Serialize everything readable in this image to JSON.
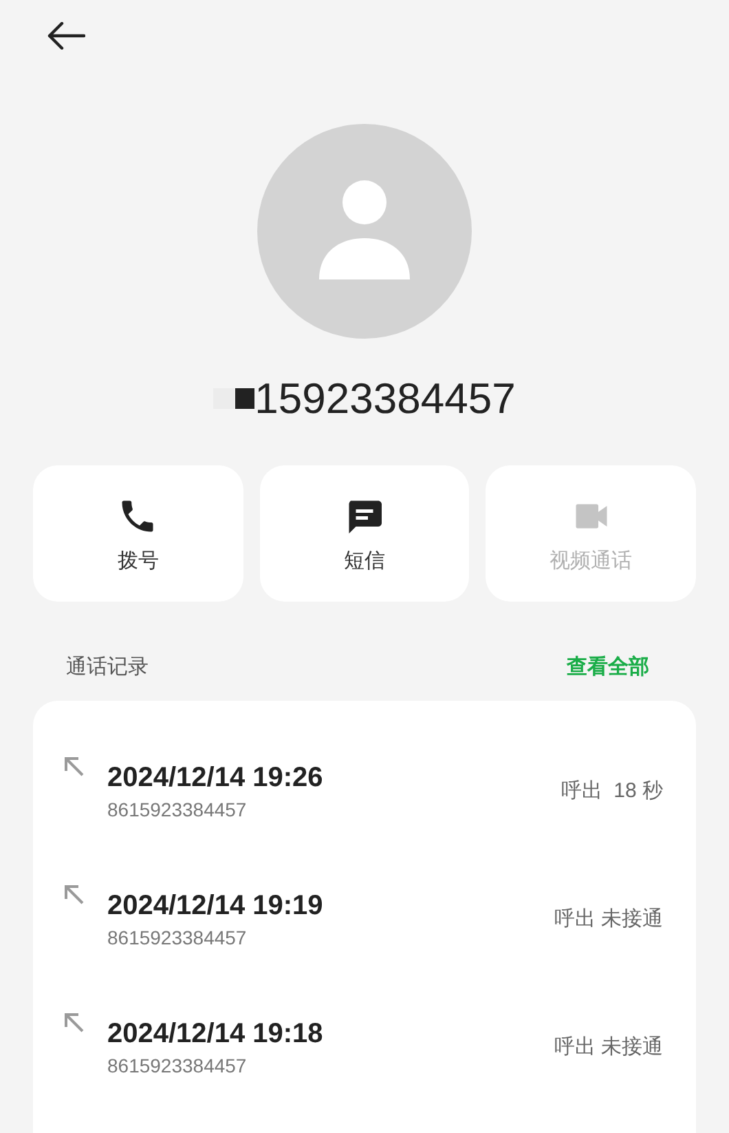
{
  "contact": {
    "number": "15923384457"
  },
  "actions": [
    {
      "kind": "phone",
      "label": "拨号",
      "disabled": false
    },
    {
      "kind": "message",
      "label": "短信",
      "disabled": false
    },
    {
      "kind": "video",
      "label": "视频通话",
      "disabled": true
    }
  ],
  "call_log": {
    "title": "通话记录",
    "view_all": "查看全部",
    "entries": [
      {
        "time": "2024/12/14 19:26",
        "number": "8615923384457",
        "status": "呼出  18 秒"
      },
      {
        "time": "2024/12/14 19:19",
        "number": "8615923384457",
        "status": "呼出 未接通"
      },
      {
        "time": "2024/12/14 19:18",
        "number": "8615923384457",
        "status": "呼出 未接通"
      }
    ]
  }
}
